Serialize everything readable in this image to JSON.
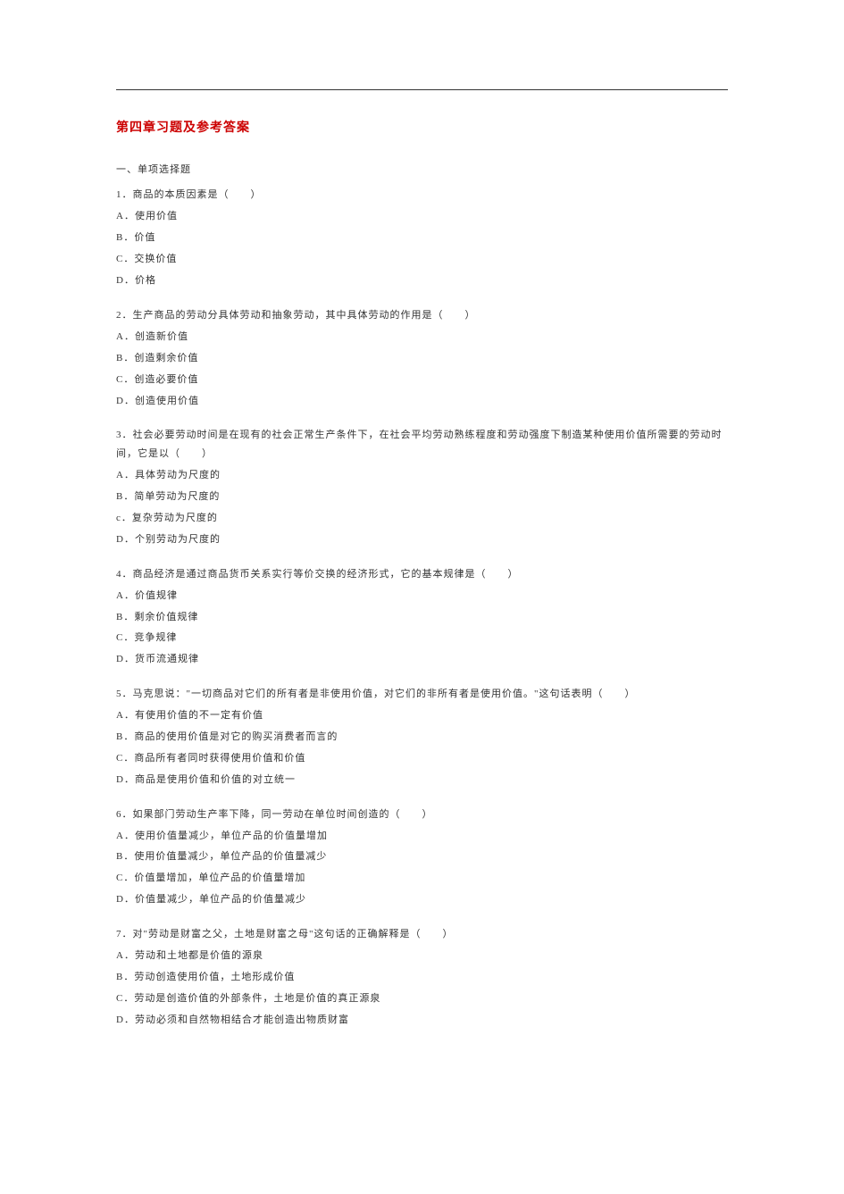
{
  "title": "第四章习题及参考答案",
  "section_heading": "一、单项选择题",
  "questions": [
    {
      "stem": "1．商品的本质因素是（　　）",
      "options": [
        "A．使用价值",
        "B．价值",
        "C．交换价值",
        "D．价格"
      ]
    },
    {
      "stem": "2．生产商品的劳动分具体劳动和抽象劳动，其中具体劳动的作用是（　　）",
      "options": [
        "A．创造新价值",
        "B．创造剩余价值",
        "C．创造必要价值",
        "D．创造使用价值"
      ]
    },
    {
      "stem": "3．社会必要劳动时间是在现有的社会正常生产条件下，在社会平均劳动熟练程度和劳动强度下制造某种使用价值所需要的劳动时间，它是以（　　）",
      "options": [
        "A．具体劳动为尺度的",
        "B．简单劳动为尺度的",
        "c．复杂劳动为尺度的",
        "D．个别劳动为尺度的"
      ]
    },
    {
      "stem": "4．商品经济是通过商品货币关系实行等价交换的经济形式，它的基本规律是（　　）",
      "options": [
        "A．价值规律",
        "B．剩余价值规律",
        "C．竞争规律",
        "D．货币流通规律"
      ]
    },
    {
      "stem": "5．马克思说：\"一切商品对它们的所有者是非使用价值，对它们的非所有者是使用价值。\"这句话表明（　　）",
      "options": [
        "A．有使用价值的不一定有价值",
        "B．商品的使用价值是对它的购买消费者而言的",
        "C．商品所有者同时获得使用价值和价值",
        "D．商品是使用价值和价值的对立统一"
      ]
    },
    {
      "stem": "6．如果部门劳动生产率下降，同一劳动在单位时间创造的（　　）",
      "options": [
        "A．使用价值量减少，单位产品的价值量增加",
        "B．使用价值量减少，单位产品的价值量减少",
        "C．价值量增加，单位产品的价值量增加",
        "D．价值量减少，单位产品的价值量减少"
      ]
    },
    {
      "stem": "7．对\"劳动是财富之父，土地是财富之母\"这句话的正确解释是（　　）",
      "options": [
        "A．劳动和土地都是价值的源泉",
        "B．劳动创造使用价值，土地形成价值",
        "C．劳动是创造价值的外部条件，土地是价值的真正源泉",
        "D．劳动必须和自然物相结合才能创造出物质财富"
      ]
    }
  ]
}
